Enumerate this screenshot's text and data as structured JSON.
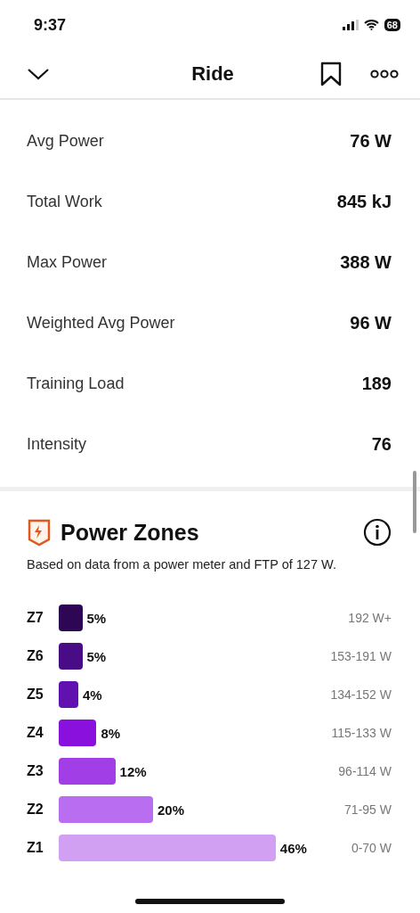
{
  "status_bar": {
    "time": "9:37",
    "battery": "68"
  },
  "header": {
    "title": "Ride"
  },
  "stats": [
    {
      "label": "Avg Power",
      "value": "76 W"
    },
    {
      "label": "Total Work",
      "value": "845 kJ"
    },
    {
      "label": "Max Power",
      "value": "388 W"
    },
    {
      "label": "Weighted Avg Power",
      "value": "96 W"
    },
    {
      "label": "Training Load",
      "value": "189"
    },
    {
      "label": "Intensity",
      "value": "76"
    }
  ],
  "power_zones": {
    "title": "Power Zones",
    "subtitle": "Based on data from a power meter and FTP of 127 W.",
    "chart_data": {
      "type": "bar",
      "orientation": "horizontal",
      "categories": [
        "Z7",
        "Z6",
        "Z5",
        "Z4",
        "Z3",
        "Z2",
        "Z1"
      ],
      "values": [
        5,
        5,
        4,
        8,
        12,
        20,
        46
      ],
      "value_labels": [
        "5%",
        "5%",
        "4%",
        "8%",
        "12%",
        "20%",
        "46%"
      ]
    },
    "zones": [
      {
        "range": "192 W+",
        "color": "#2e0754"
      },
      {
        "range": "153-191 W",
        "color": "#4a0b87"
      },
      {
        "range": "134-152 W",
        "color": "#6111b0"
      },
      {
        "range": "115-133 W",
        "color": "#8a10dd"
      },
      {
        "range": "96-114 W",
        "color": "#a23ee6"
      },
      {
        "range": "71-95 W",
        "color": "#b96df0"
      },
      {
        "range": "0-70 W",
        "color": "#d2a0f3"
      }
    ]
  }
}
